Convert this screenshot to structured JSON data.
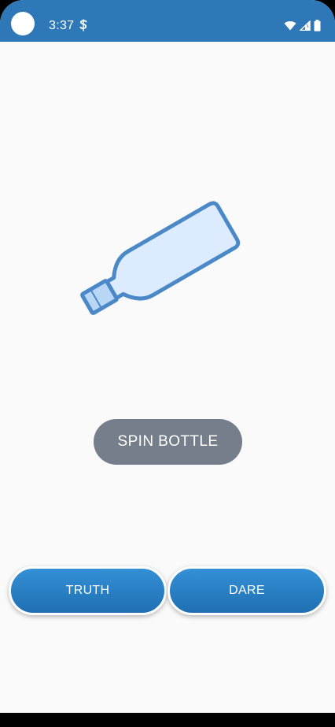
{
  "status_bar": {
    "time": "3:37",
    "background": "#2f78b8",
    "icons": [
      "camera-cutout-icon",
      "app-notification-icon",
      "wifi-icon",
      "cellular-signal-icon",
      "battery-icon"
    ]
  },
  "bottle": {
    "icon": "bottle-icon",
    "stroke_color": "#4a88c7",
    "fill_color": "#dcebfd",
    "cap_color": "#b9d6f5"
  },
  "spin_button": {
    "label": "SPIN BOTTLE",
    "color": "#767e8c"
  },
  "choices": {
    "truth_label": "TRUTH",
    "dare_label": "DARE",
    "color": "#2a80c6"
  }
}
